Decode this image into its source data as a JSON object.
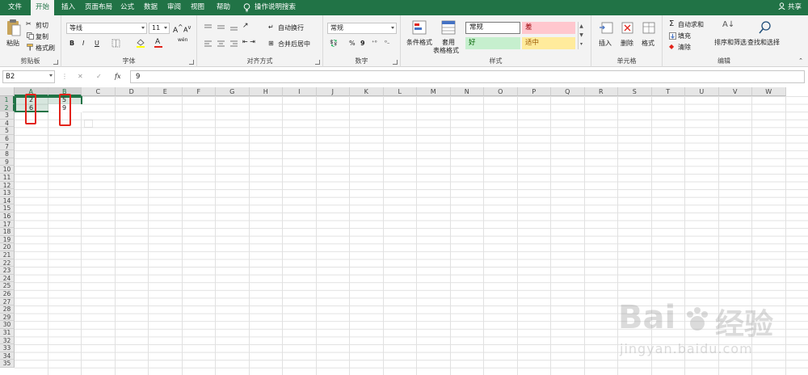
{
  "menu": {
    "tabs": [
      "文件",
      "开始",
      "插入",
      "页面布局",
      "公式",
      "数据",
      "审阅",
      "视图",
      "帮助"
    ],
    "active_index": 1,
    "tell_me": "操作说明搜索",
    "share": "共享"
  },
  "ribbon": {
    "clipboard": {
      "paste": "粘贴",
      "cut": "剪切",
      "copy": "复制",
      "format_painter": "格式刷",
      "label": "剪贴板"
    },
    "font": {
      "name": "等线",
      "size": "11",
      "bold": "B",
      "italic": "I",
      "underline": "U",
      "grow": "A",
      "shrink": "A",
      "font_color_glyph": "A",
      "phonetic": "wén",
      "label": "字体"
    },
    "alignment": {
      "wrap": "自动换行",
      "merge": "合并后居中",
      "label": "对齐方式"
    },
    "number": {
      "format": "常规",
      "percent": "%",
      "comma": "9",
      "label": "数字"
    },
    "styles": {
      "conditional": "条件格式",
      "table_format_1": "套用",
      "table_format_2": "表格格式",
      "normal": "常规",
      "bad": "差",
      "good": "好",
      "neutral": "适中",
      "label": "样式"
    },
    "cells": {
      "insert": "插入",
      "delete": "删除",
      "format": "格式",
      "label": "单元格"
    },
    "editing": {
      "autosum": "自动求和",
      "fill": "填充",
      "clear": "清除",
      "sort": "排序和筛选",
      "find": "查找和选择",
      "label": "编辑"
    }
  },
  "formula_bar": {
    "name_box": "B2",
    "cancel": "✕",
    "enter": "✓",
    "fx": "fx",
    "value": "9"
  },
  "sheet": {
    "columns": [
      "A",
      "B",
      "C",
      "D",
      "E",
      "F",
      "G",
      "H",
      "I",
      "J",
      "K",
      "L",
      "M",
      "N",
      "O",
      "P",
      "Q",
      "R",
      "S",
      "T",
      "U",
      "V",
      "W"
    ],
    "row_count": 35,
    "cells": {
      "A1": "2",
      "B1": "5",
      "A2": "6",
      "B2": "9"
    }
  },
  "colors": {
    "brand": "#217346",
    "highlight": "#e2231a"
  },
  "watermark": {
    "logo": "Bai",
    "logo_cn": "经验",
    "url": "jingyan.baidu.com"
  }
}
